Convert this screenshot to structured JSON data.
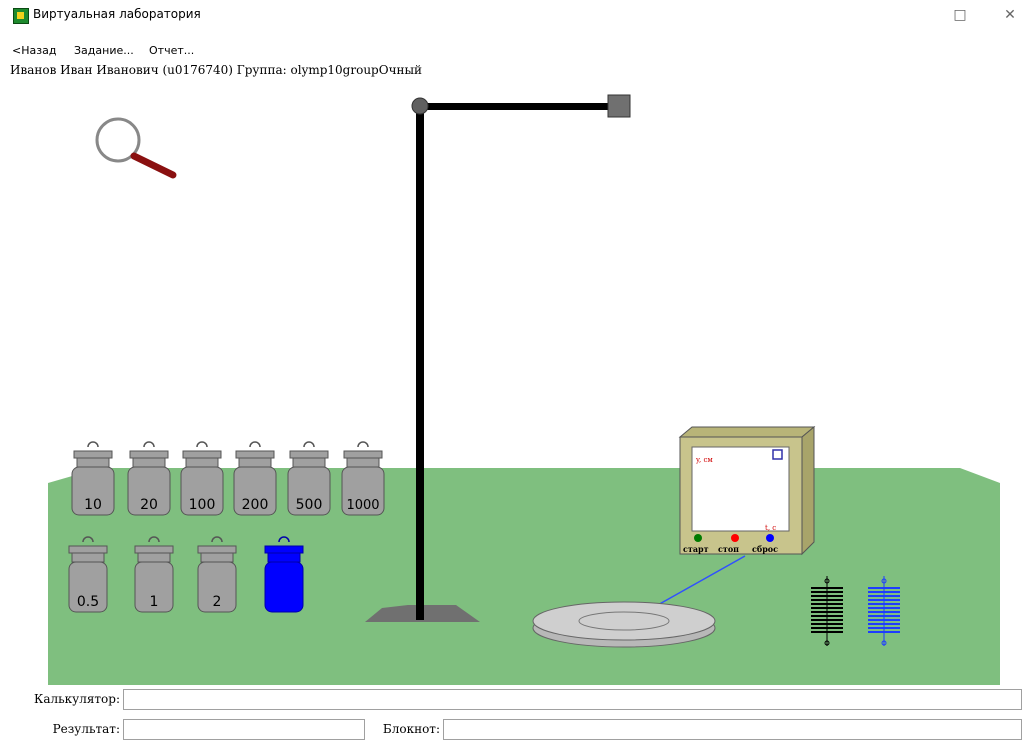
{
  "window": {
    "title": "Виртуальная лаборатория",
    "icon": "app-icon",
    "buttons": {
      "maximize": "□",
      "close": "✕"
    }
  },
  "menu": {
    "back": "<Назад",
    "task": "Задание...",
    "report": "Отчет..."
  },
  "user": {
    "info": "Иванов Иван Иванович (u0176740)  Группа: olymp10groupОчный"
  },
  "lab": {
    "weights_row1": [
      "10",
      "20",
      "100",
      "200",
      "500",
      "1000"
    ],
    "weights_row2": [
      "0.5",
      "1",
      "2"
    ],
    "device": {
      "y_label": "y, см",
      "x_label": "t, с",
      "start": "старт",
      "stop": "стоп",
      "reset": "сброс"
    },
    "colors": {
      "table": "#7fbf7f",
      "weight": "#a0a0a0",
      "blue_weight": "#0000ff",
      "device": "#c8c48c",
      "spring_black": "#000000",
      "spring_blue": "#1e3cff"
    }
  },
  "bottom": {
    "calculator_label": "Калькулятор:",
    "calculator_value": "",
    "result_label": "Результат:",
    "result_value": "",
    "notepad_label": "Блокнот:",
    "notepad_value": ""
  }
}
